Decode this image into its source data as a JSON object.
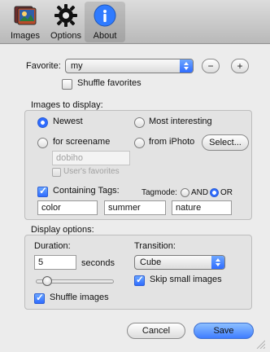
{
  "toolbar": {
    "items": [
      {
        "label": "Images",
        "icon": "images-icon"
      },
      {
        "label": "Options",
        "icon": "gear-icon"
      },
      {
        "label": "About",
        "icon": "info-icon",
        "selected": true
      }
    ]
  },
  "favorite": {
    "label": "Favorite:",
    "value": "my",
    "remove_label": "−",
    "add_label": "+",
    "shuffle_label": "Shuffle favorites",
    "shuffle_checked": false
  },
  "images_to_display": {
    "title": "Images to display:",
    "options": {
      "newest": "Newest",
      "most_interesting": "Most interesting",
      "for_screenname": "for screename",
      "from_iphoto": "from iPhoto"
    },
    "selected": "newest",
    "screenname_value": "dobiho",
    "users_favorites_label": "User's favorites",
    "select_button": "Select...",
    "containing_tags_label": "Containing Tags:",
    "containing_tags_checked": true,
    "tagmode_label": "Tagmode:",
    "tagmode_and": "AND",
    "tagmode_or": "OR",
    "tagmode_selected": "or",
    "tags": [
      "color",
      "summer",
      "nature"
    ]
  },
  "display_options": {
    "title": "Display options:",
    "duration_label": "Duration:",
    "duration_value": "5",
    "seconds_label": "seconds",
    "duration_level": 0.1,
    "transition_label": "Transition:",
    "transition_value": "Cube",
    "skip_small_label": "Skip small images",
    "skip_small_checked": true,
    "shuffle_images_label": "Shuffle images",
    "shuffle_images_checked": true
  },
  "dialog": {
    "cancel": "Cancel",
    "save": "Save"
  }
}
